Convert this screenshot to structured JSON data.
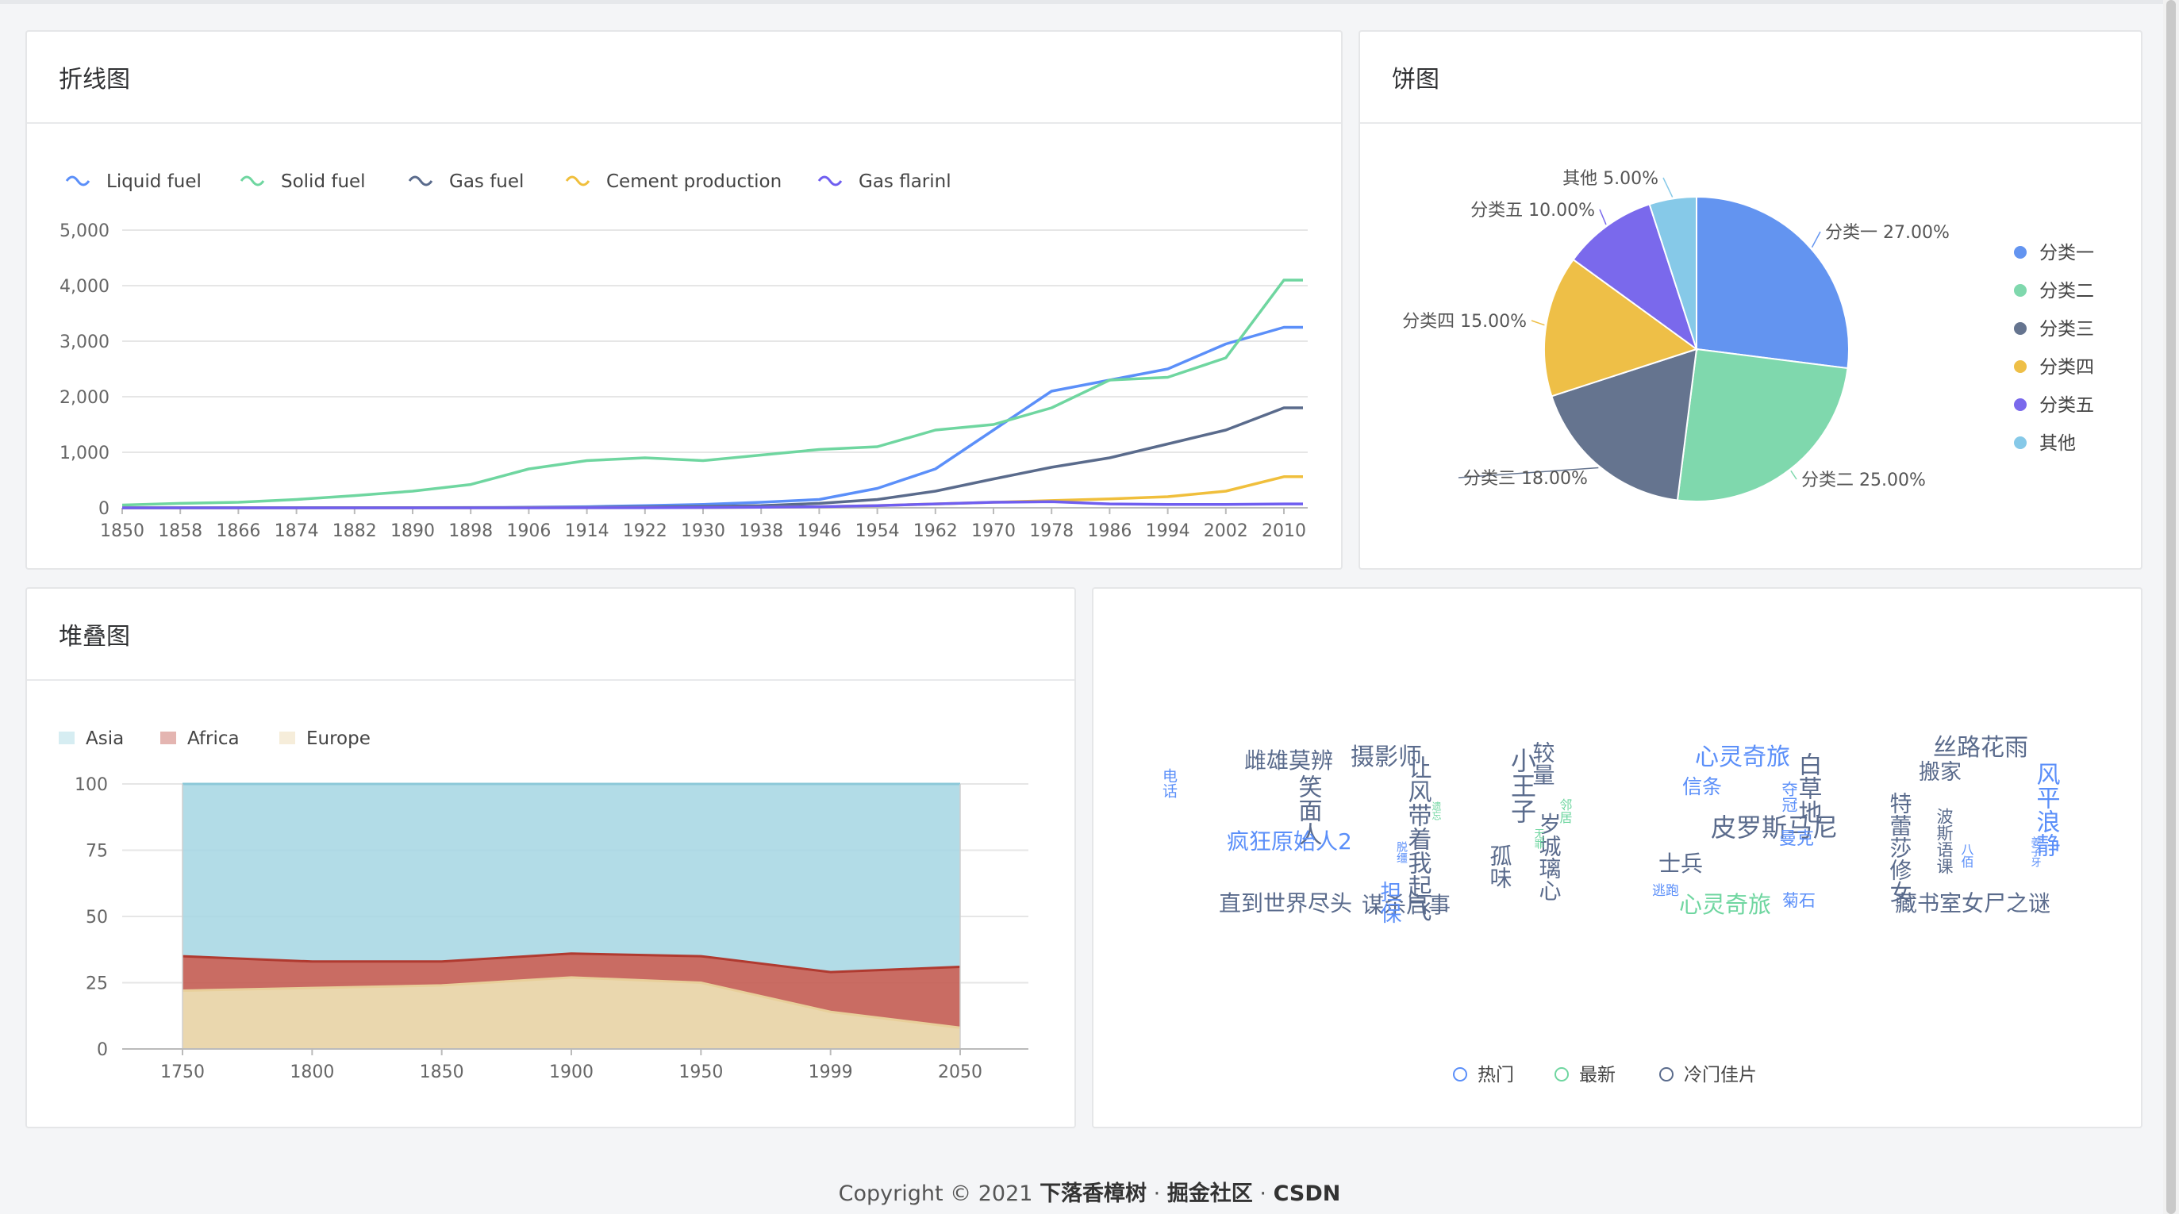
{
  "cards": {
    "line": {
      "title": "折线图"
    },
    "pie": {
      "title": "饼图"
    },
    "stack": {
      "title": "堆叠图"
    }
  },
  "footer": {
    "prefix": "Copyright © 2021",
    "author": "下落香樟树",
    "sep": " · ",
    "site1": "掘金社区",
    "site2": "CSDN"
  },
  "chart_data": [
    {
      "type": "line",
      "categories": [
        "1850",
        "1858",
        "1866",
        "1874",
        "1882",
        "1890",
        "1898",
        "1906",
        "1914",
        "1922",
        "1930",
        "1938",
        "1946",
        "1954",
        "1962",
        "1970",
        "1978",
        "1986",
        "1994",
        "2002",
        "2010"
      ],
      "ylim": [
        0,
        5000
      ],
      "yticks": [
        0,
        1000,
        2000,
        3000,
        4000,
        5000
      ],
      "ytick_labels": [
        "0",
        "1,000",
        "2,000",
        "3,000",
        "4,000",
        "5,000"
      ],
      "grid": true,
      "legend_position": "top-left",
      "series": [
        {
          "name": "Liquid fuel",
          "color": "#5b8ff9",
          "values": [
            0,
            0,
            1,
            1,
            2,
            3,
            5,
            10,
            20,
            40,
            60,
            100,
            150,
            350,
            700,
            1400,
            2100,
            2300,
            2500,
            2950,
            3250
          ]
        },
        {
          "name": "Solid fuel",
          "color": "#6fd6a0",
          "values": [
            50,
            80,
            100,
            150,
            220,
            300,
            420,
            700,
            850,
            900,
            850,
            950,
            1050,
            1100,
            1400,
            1500,
            1800,
            2300,
            2350,
            2700,
            4100
          ]
        },
        {
          "name": "Gas fuel",
          "color": "#5a6b8c",
          "values": [
            0,
            0,
            0,
            0,
            1,
            2,
            3,
            5,
            8,
            15,
            25,
            40,
            80,
            150,
            300,
            520,
            730,
            900,
            1150,
            1400,
            1800
          ]
        },
        {
          "name": "Cement production",
          "color": "#f0bf3c",
          "values": [
            0,
            0,
            0,
            0,
            0,
            0,
            0,
            1,
            2,
            4,
            6,
            10,
            20,
            40,
            70,
            100,
            130,
            160,
            200,
            300,
            560
          ]
        },
        {
          "name": "Gas flarinl",
          "color": "#6f5ef0",
          "values": [
            0,
            0,
            0,
            0,
            0,
            0,
            0,
            0,
            1,
            2,
            5,
            10,
            20,
            40,
            70,
            100,
            110,
            70,
            60,
            60,
            70
          ]
        }
      ]
    },
    {
      "type": "pie",
      "legend_position": "right",
      "slices": [
        {
          "name": "分类一",
          "value": 27,
          "label": "分类一 27.00%",
          "color": "#6394f0"
        },
        {
          "name": "分类二",
          "value": 25,
          "label": "分类二 25.00%",
          "color": "#7fd8ad"
        },
        {
          "name": "分类三",
          "value": 18,
          "label": "分类三 18.00%",
          "color": "#65748f"
        },
        {
          "name": "分类四",
          "value": 15,
          "label": "分类四 15.00%",
          "color": "#eebf47"
        },
        {
          "name": "分类五",
          "value": 10,
          "label": "分类五 10.00%",
          "color": "#7a69ec"
        },
        {
          "name": "其他",
          "value": 5,
          "label": "其他 5.00%",
          "color": "#86c9e8"
        }
      ]
    },
    {
      "type": "area",
      "stacked": "percent",
      "categories": [
        "1750",
        "1800",
        "1850",
        "1900",
        "1950",
        "1999",
        "2050"
      ],
      "ylim": [
        0,
        100
      ],
      "yticks": [
        0,
        25,
        50,
        75,
        100
      ],
      "grid": true,
      "legend_position": "top-left",
      "series": [
        {
          "name": "Asia",
          "color": "#a5d6e3",
          "values": [
            65,
            67,
            67,
            64,
            65,
            71,
            69
          ]
        },
        {
          "name": "Africa",
          "color": "#c35c52",
          "values": [
            13,
            10,
            9,
            9,
            10,
            15,
            23
          ]
        },
        {
          "name": "Europe",
          "color": "#ead7ae",
          "values": [
            22,
            23,
            24,
            27,
            25,
            14,
            8
          ]
        }
      ]
    },
    {
      "type": "wordcloud",
      "legend": [
        {
          "name": "热门",
          "color": "#5b8ff9"
        },
        {
          "name": "最新",
          "color": "#6fd6a0"
        },
        {
          "name": "冷门佳片",
          "color": "#5a6b8c"
        }
      ],
      "words": [
        {
          "text": "雌雄莫辨",
          "group": "冷门佳片"
        },
        {
          "text": "笑面人",
          "group": "冷门佳片"
        },
        {
          "text": "电话",
          "group": "热门"
        },
        {
          "text": "疯狂原始人2",
          "group": "热门"
        },
        {
          "text": "直到世界尽头",
          "group": "冷门佳片"
        },
        {
          "text": "摄影师",
          "group": "冷门佳片"
        },
        {
          "text": "让风带着我起飞",
          "group": "冷门佳片"
        },
        {
          "text": "小王子",
          "group": "冷门佳片"
        },
        {
          "text": "较量",
          "group": "冷门佳片"
        },
        {
          "text": "岁城璃心",
          "group": "冷门佳片"
        },
        {
          "text": "孤味",
          "group": "冷门佳片"
        },
        {
          "text": "谋杀启事",
          "group": "冷门佳片"
        },
        {
          "text": "担保",
          "group": "热门"
        },
        {
          "text": "脱缰",
          "group": "热门"
        },
        {
          "text": "遗忘",
          "group": "最新"
        },
        {
          "text": "邻居",
          "group": "最新"
        },
        {
          "text": "无罪",
          "group": "最新"
        },
        {
          "text": "心灵奇旅",
          "group": "热门"
        },
        {
          "text": "白草地",
          "group": "冷门佳片"
        },
        {
          "text": "信条",
          "group": "热门"
        },
        {
          "text": "夺冠",
          "group": "热门"
        },
        {
          "text": "皮罗斯马尼",
          "group": "冷门佳片"
        },
        {
          "text": "曼克",
          "group": "热门"
        },
        {
          "text": "士兵",
          "group": "冷门佳片"
        },
        {
          "text": "逃跑",
          "group": "热门"
        },
        {
          "text": "心灵奇旅",
          "group": "最新"
        },
        {
          "text": "菊石",
          "group": "热门"
        },
        {
          "text": "丝路花雨",
          "group": "冷门佳片"
        },
        {
          "text": "搬家",
          "group": "冷门佳片"
        },
        {
          "text": "特蕾莎修女",
          "group": "冷门佳片"
        },
        {
          "text": "波斯语课",
          "group": "冷门佳片"
        },
        {
          "text": "八佰",
          "group": "热门"
        },
        {
          "text": "姜子牙",
          "group": "热门"
        },
        {
          "text": "风平浪静",
          "group": "热门"
        },
        {
          "text": "藏书室女尸之谜",
          "group": "冷门佳片"
        }
      ]
    }
  ]
}
